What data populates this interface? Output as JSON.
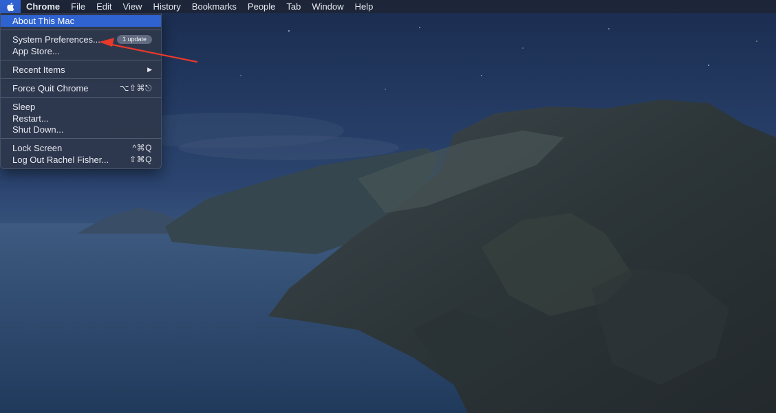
{
  "menubar": {
    "app_name": "Chrome",
    "items": [
      "File",
      "Edit",
      "View",
      "History",
      "Bookmarks",
      "People",
      "Tab",
      "Window",
      "Help"
    ]
  },
  "apple_menu": {
    "icon": "apple-logo-icon",
    "items": {
      "about": "About This Mac",
      "system_preferences": "System Preferences...",
      "system_preferences_badge": "1 update",
      "app_store": "App Store...",
      "recent_items": "Recent Items",
      "force_quit": "Force Quit Chrome",
      "force_quit_shortcut": "⌥⇧⌘⎋",
      "sleep": "Sleep",
      "restart": "Restart...",
      "shut_down": "Shut Down...",
      "lock_screen": "Lock Screen",
      "lock_screen_shortcut": "^⌘Q",
      "log_out": "Log Out Rachel Fisher...",
      "log_out_shortcut": "⇧⌘Q"
    }
  },
  "colors": {
    "highlight": "#2f63d1",
    "annotation_arrow": "#e8392b"
  }
}
